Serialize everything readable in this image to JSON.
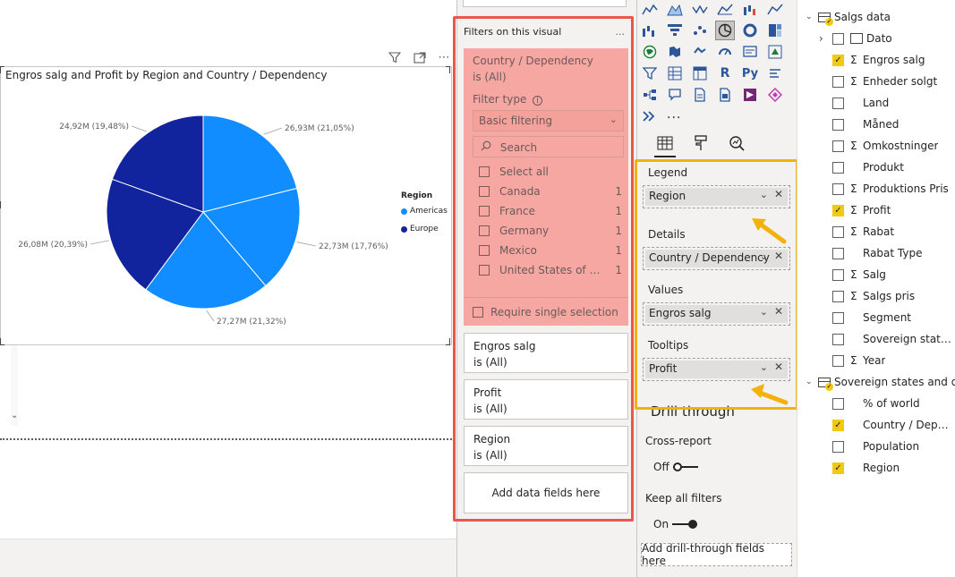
{
  "chart": {
    "title": "Engros salg and Profit by Region and Country / Dependency",
    "legend_title": "Region",
    "legend_items": [
      {
        "label": "Americas",
        "color": "#118dff"
      },
      {
        "label": "Europe",
        "color": "#12239e"
      }
    ]
  },
  "chart_data": {
    "type": "pie",
    "title": "Engros salg and Profit by Region and Country / Dependency",
    "legend_title": "Region",
    "slices": [
      {
        "label": "26,93M (21,05%)",
        "value": 26.93,
        "percent": 21.05,
        "series": "Americas",
        "color": "#118dff"
      },
      {
        "label": "22,73M (17,76%)",
        "value": 22.73,
        "percent": 17.76,
        "series": "Americas",
        "color": "#118dff"
      },
      {
        "label": "27,27M (21,32%)",
        "value": 27.27,
        "percent": 21.32,
        "series": "Americas",
        "color": "#118dff"
      },
      {
        "label": "26,08M (20,39%)",
        "value": 26.08,
        "percent": 20.39,
        "series": "Europe",
        "color": "#12239e"
      },
      {
        "label": "24,92M (19,48%)",
        "value": 24.92,
        "percent": 19.48,
        "series": "Europe",
        "color": "#12239e"
      }
    ]
  },
  "filters": {
    "header": "Filters on this visual",
    "more": "...",
    "country_card": {
      "title_line1": "Country / Dependency",
      "title_line2": "is (All)",
      "filter_type_label": "Filter type",
      "filter_type_value": "Basic filtering",
      "search_placeholder": "Search",
      "select_all": "Select all",
      "items": [
        {
          "label": "Canada",
          "count": "1"
        },
        {
          "label": "France",
          "count": "1"
        },
        {
          "label": "Germany",
          "count": "1"
        },
        {
          "label": "Mexico",
          "count": "1"
        },
        {
          "label": "United States of America",
          "count": "1"
        }
      ],
      "require_single": "Require single selection"
    },
    "cards": [
      {
        "line1": "Engros salg",
        "line2": "is (All)"
      },
      {
        "line1": "Profit",
        "line2": "is (All)"
      },
      {
        "line1": "Region",
        "line2": "is (All)"
      }
    ],
    "add_data_fields": "Add data fields here"
  },
  "viz": {
    "more": "...",
    "wells": {
      "legend_label": "Legend",
      "legend_value": "Region",
      "details_label": "Details",
      "details_value": "Country / Dependency",
      "values_label": "Values",
      "values_value": "Engros salg",
      "tooltips_label": "Tooltips",
      "tooltips_value": "Profit"
    },
    "drill_through": "Drill through",
    "cross_report_label": "Cross-report",
    "cross_report_state": "Off",
    "keep_all_filters_label": "Keep all filters",
    "keep_all_filters_state": "On",
    "add_drill": "Add drill-through fields here"
  },
  "fields": {
    "table1": "Salgs data",
    "table1_fields": [
      {
        "label": "Dato",
        "checked": false,
        "type": "date"
      },
      {
        "label": "Engros salg",
        "checked": true,
        "type": "sum"
      },
      {
        "label": "Enheder solgt",
        "checked": false,
        "type": "sum"
      },
      {
        "label": "Land",
        "checked": false,
        "type": "text"
      },
      {
        "label": "Måned",
        "checked": false,
        "type": "text"
      },
      {
        "label": "Omkostninger",
        "checked": false,
        "type": "sum"
      },
      {
        "label": "Produkt",
        "checked": false,
        "type": "text"
      },
      {
        "label": "Produktions Pris",
        "checked": false,
        "type": "sum"
      },
      {
        "label": "Profit",
        "checked": true,
        "type": "sum"
      },
      {
        "label": "Rabat",
        "checked": false,
        "type": "sum"
      },
      {
        "label": "Rabat Type",
        "checked": false,
        "type": "text"
      },
      {
        "label": "Salg",
        "checked": false,
        "type": "sum"
      },
      {
        "label": "Salgs pris",
        "checked": false,
        "type": "sum"
      },
      {
        "label": "Segment",
        "checked": false,
        "type": "text"
      },
      {
        "label": "Sovereign states ...",
        "checked": false,
        "type": "text"
      },
      {
        "label": "Year",
        "checked": false,
        "type": "sum"
      }
    ],
    "table2": "Sovereign states and d...",
    "table2_fields": [
      {
        "label": "% of world",
        "checked": false,
        "type": "text"
      },
      {
        "label": "Country / Depen...",
        "checked": true,
        "type": "text"
      },
      {
        "label": "Population",
        "checked": false,
        "type": "text"
      },
      {
        "label": "Region",
        "checked": true,
        "type": "text"
      }
    ]
  }
}
